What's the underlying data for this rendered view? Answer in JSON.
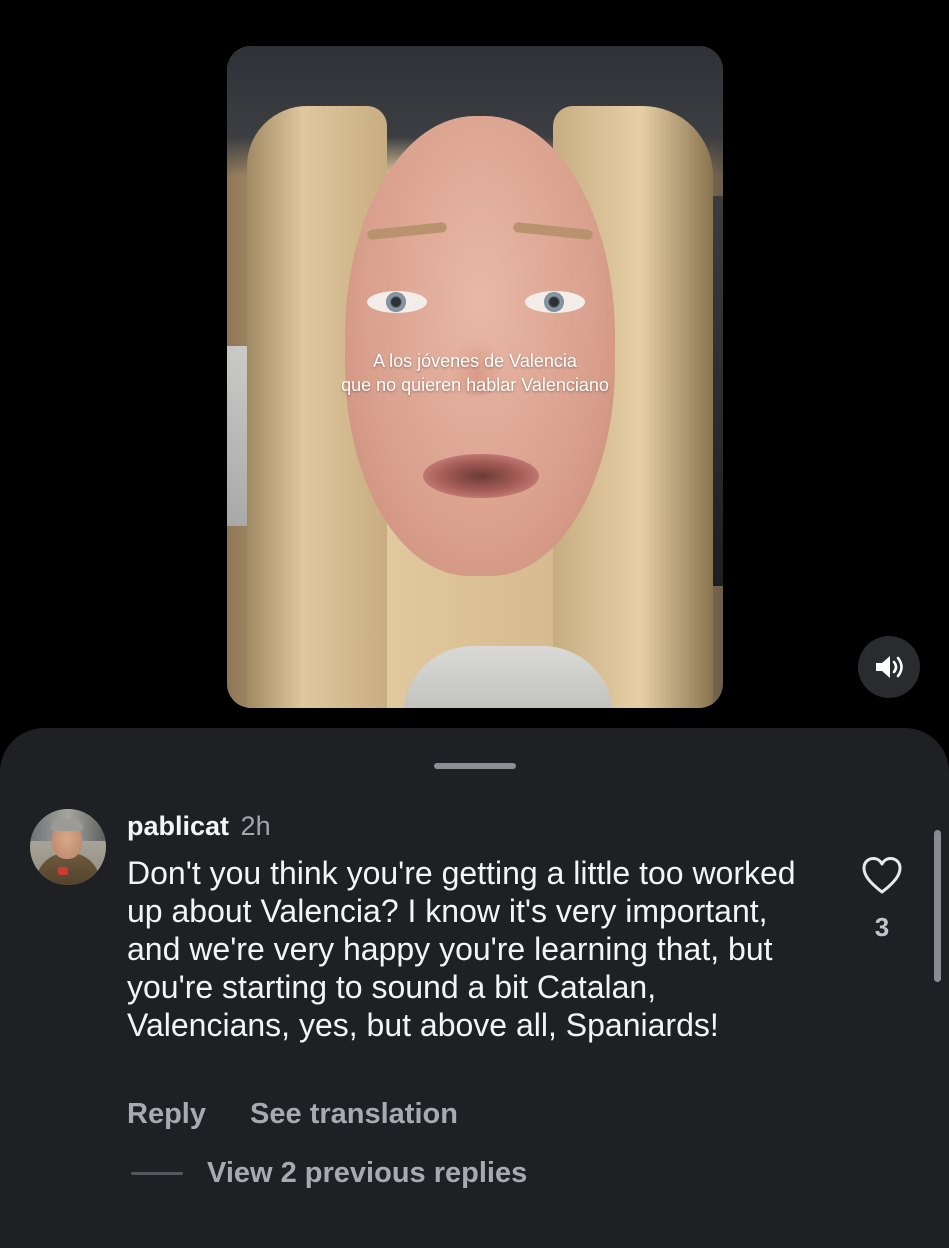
{
  "video": {
    "caption_line1": "A los jóvenes de Valencia",
    "caption_line2": "que no quieren hablar Valenciano"
  },
  "sound_button": {
    "icon": "speaker-on-icon"
  },
  "comments_sheet": {
    "comment": {
      "username": "pablicat",
      "time": "2h",
      "text": "Don't you think you're getting a little too worked up about Valencia? I know it's very important, and we're very happy you're learning that, but you're starting to sound a bit Catalan, Valencians, yes, but above all, Spaniards!",
      "like_icon": "heart-outline-icon",
      "like_count": "3",
      "reply_label": "Reply",
      "translation_label": "See translation",
      "view_replies_label": "View 2 previous replies"
    }
  },
  "colors": {
    "background": "#000000",
    "sheet": "#1e2024",
    "primary_text": "#f4f4f6",
    "secondary_text": "#a8aab0"
  }
}
